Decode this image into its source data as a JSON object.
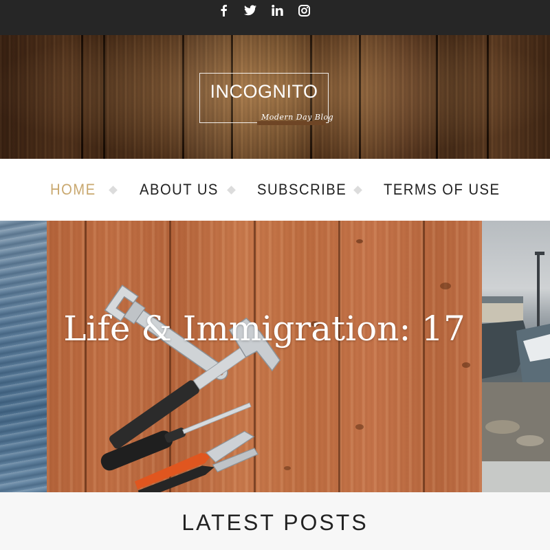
{
  "social": {
    "icons": [
      "facebook-icon",
      "twitter-icon",
      "linkedin-icon",
      "instagram-icon"
    ]
  },
  "header": {
    "logo_title": "INCOGNITO",
    "logo_tagline": "Modern Day Blog"
  },
  "nav": {
    "items": [
      {
        "label": "HOME",
        "active": true
      },
      {
        "label": "ABOUT US",
        "active": false
      },
      {
        "label": "SUBSCRIBE",
        "active": false
      },
      {
        "label": "TERMS OF USE",
        "active": false
      }
    ]
  },
  "slider": {
    "title": "Life & Immigration: 17"
  },
  "latest": {
    "title": "LATEST POSTS"
  },
  "colors": {
    "topbar": "#262626",
    "accent_active": "#c9a86f",
    "nav_text": "#222222"
  }
}
